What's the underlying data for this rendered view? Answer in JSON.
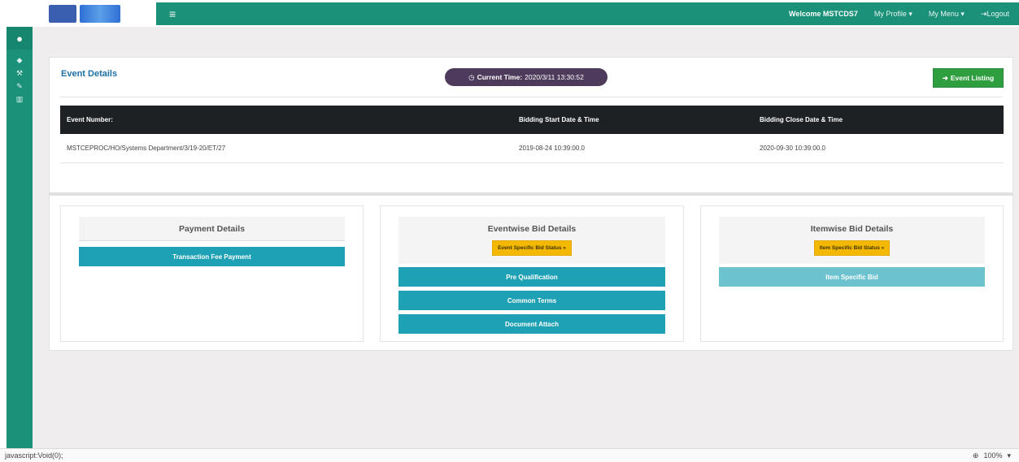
{
  "header": {
    "welcome": "Welcome MSTCDS7",
    "my_profile": "My Profile ▾",
    "my_menu": "My Menu ▾",
    "logout": "Logout",
    "logo_left": "MSTC",
    "logo_right": "MSTC"
  },
  "event": {
    "title": "Event Details",
    "current_time_label": "Current Time:",
    "current_time_value": "2020/3/11 13:30:52",
    "listing_button": "Event Listing",
    "table": {
      "headers": [
        "Event Number:",
        "Bidding Start Date & Time",
        "Bidding Close Date & Time"
      ],
      "row": [
        "MSTCEPROC/HO/Systems Department/3/19-20/ET/27",
        "2019-08-24 10:39:00.0",
        "2020-09-30 10:39:00.0"
      ]
    }
  },
  "panels": {
    "payment": {
      "title": "Payment Details",
      "button": "Transaction Fee Payment"
    },
    "eventwise": {
      "title": "Eventwise Bid Details",
      "status_button": "Event Specific Bid Status »",
      "buttons": [
        "Pre Qualification",
        "Common Terms",
        "Document Attach"
      ]
    },
    "itemwise": {
      "title": "Itemwise Bid Details",
      "status_button": "Item Specific Bid Status »",
      "button": "Item Specific Bid"
    }
  },
  "statusbar": {
    "url": "javascript:Void(0);",
    "zoom": "100%"
  },
  "colors": {
    "nav_green": "#1a9178",
    "time_pill": "#4e3a5b",
    "listing_green": "#2e9e3f",
    "teal_button": "#1fa1b5",
    "status_yellow": "#f5b800"
  }
}
